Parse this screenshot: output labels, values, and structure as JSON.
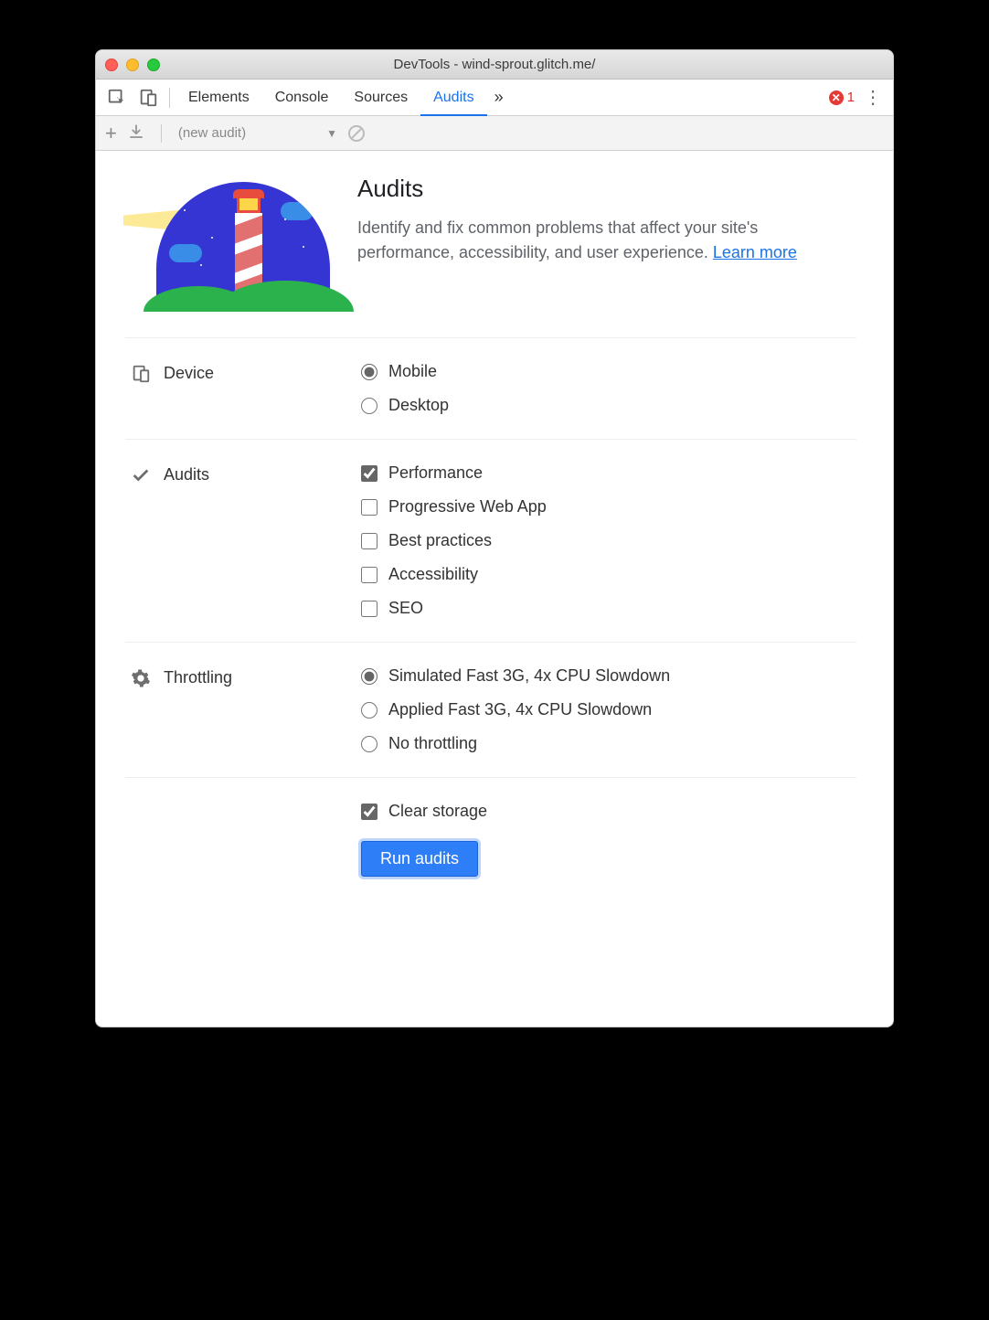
{
  "titlebar": {
    "title": "DevTools - wind-sprout.glitch.me/"
  },
  "tabs": {
    "items": [
      "Elements",
      "Console",
      "Sources",
      "Audits"
    ],
    "active_index": 3,
    "error_count": "1"
  },
  "toolbar": {
    "new_audit_label": "(new audit)"
  },
  "hero": {
    "title": "Audits",
    "description": "Identify and fix common problems that affect your site's performance, accessibility, and user experience. ",
    "learn_more": "Learn more"
  },
  "sections": {
    "device": {
      "label": "Device",
      "options": [
        {
          "label": "Mobile",
          "checked": true
        },
        {
          "label": "Desktop",
          "checked": false
        }
      ]
    },
    "audits": {
      "label": "Audits",
      "options": [
        {
          "label": "Performance",
          "checked": true
        },
        {
          "label": "Progressive Web App",
          "checked": false
        },
        {
          "label": "Best practices",
          "checked": false
        },
        {
          "label": "Accessibility",
          "checked": false
        },
        {
          "label": "SEO",
          "checked": false
        }
      ]
    },
    "throttling": {
      "label": "Throttling",
      "options": [
        {
          "label": "Simulated Fast 3G, 4x CPU Slowdown",
          "checked": true
        },
        {
          "label": "Applied Fast 3G, 4x CPU Slowdown",
          "checked": false
        },
        {
          "label": "No throttling",
          "checked": false
        }
      ]
    }
  },
  "clear_storage": {
    "label": "Clear storage",
    "checked": true
  },
  "run_button": "Run audits"
}
